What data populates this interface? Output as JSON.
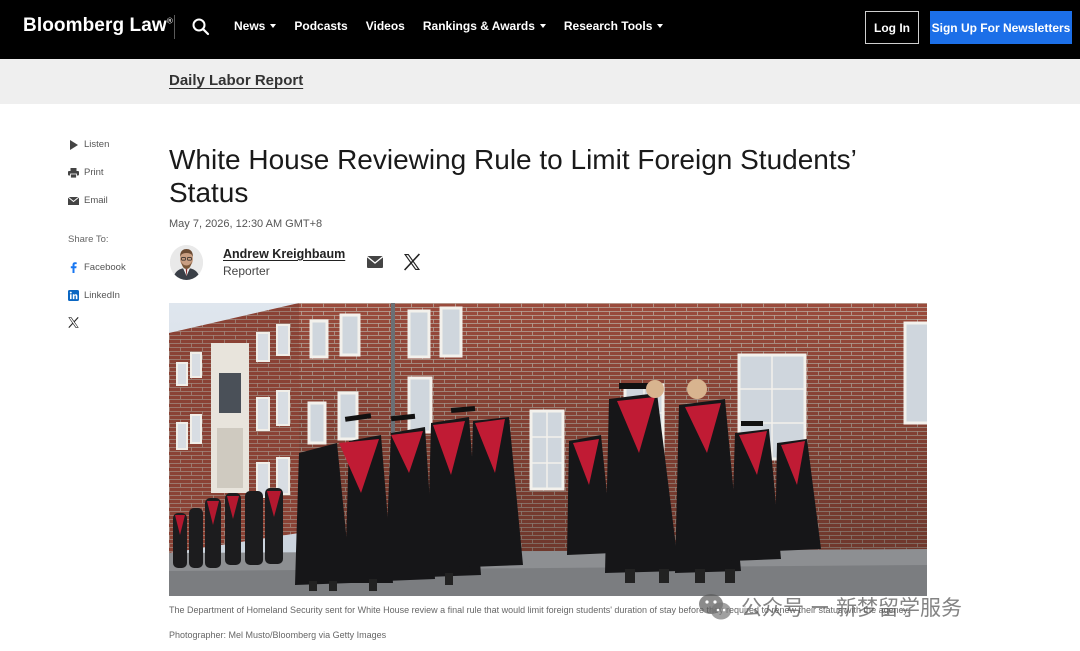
{
  "nav": {
    "logo": "Bloomberg Law",
    "logo_mark": "®",
    "links": [
      {
        "label": "News",
        "dropdown": true
      },
      {
        "label": "Podcasts",
        "dropdown": false
      },
      {
        "label": "Videos",
        "dropdown": false
      },
      {
        "label": "Rankings & Awards",
        "dropdown": true
      },
      {
        "label": "Research Tools",
        "dropdown": true
      }
    ],
    "login": "Log In",
    "signup": "Sign Up For Newsletters",
    "accent_color": "#1c6fe8"
  },
  "section": {
    "title": "Daily Labor Report"
  },
  "rail": {
    "listen": "Listen",
    "print": "Print",
    "email": "Email",
    "share_label": "Share To:",
    "facebook": "Facebook",
    "linkedin": "LinkedIn"
  },
  "article": {
    "headline": "White House Reviewing Rule to Limit Foreign Students’ Status",
    "date": "May 7, 2026, 12:30 AM GMT+8",
    "author": {
      "name": "Andrew Kreighbaum",
      "role": "Reporter"
    },
    "caption": "The Department of Homeland Security sent for White House review a final rule that would limit foreign students' duration of stay before they required to renew their status with the agency.",
    "credit": "Photographer: Mel Musto/Bloomberg via Getty Images"
  },
  "watermark": {
    "left": "公众号",
    "right": "新梦留学服务"
  }
}
